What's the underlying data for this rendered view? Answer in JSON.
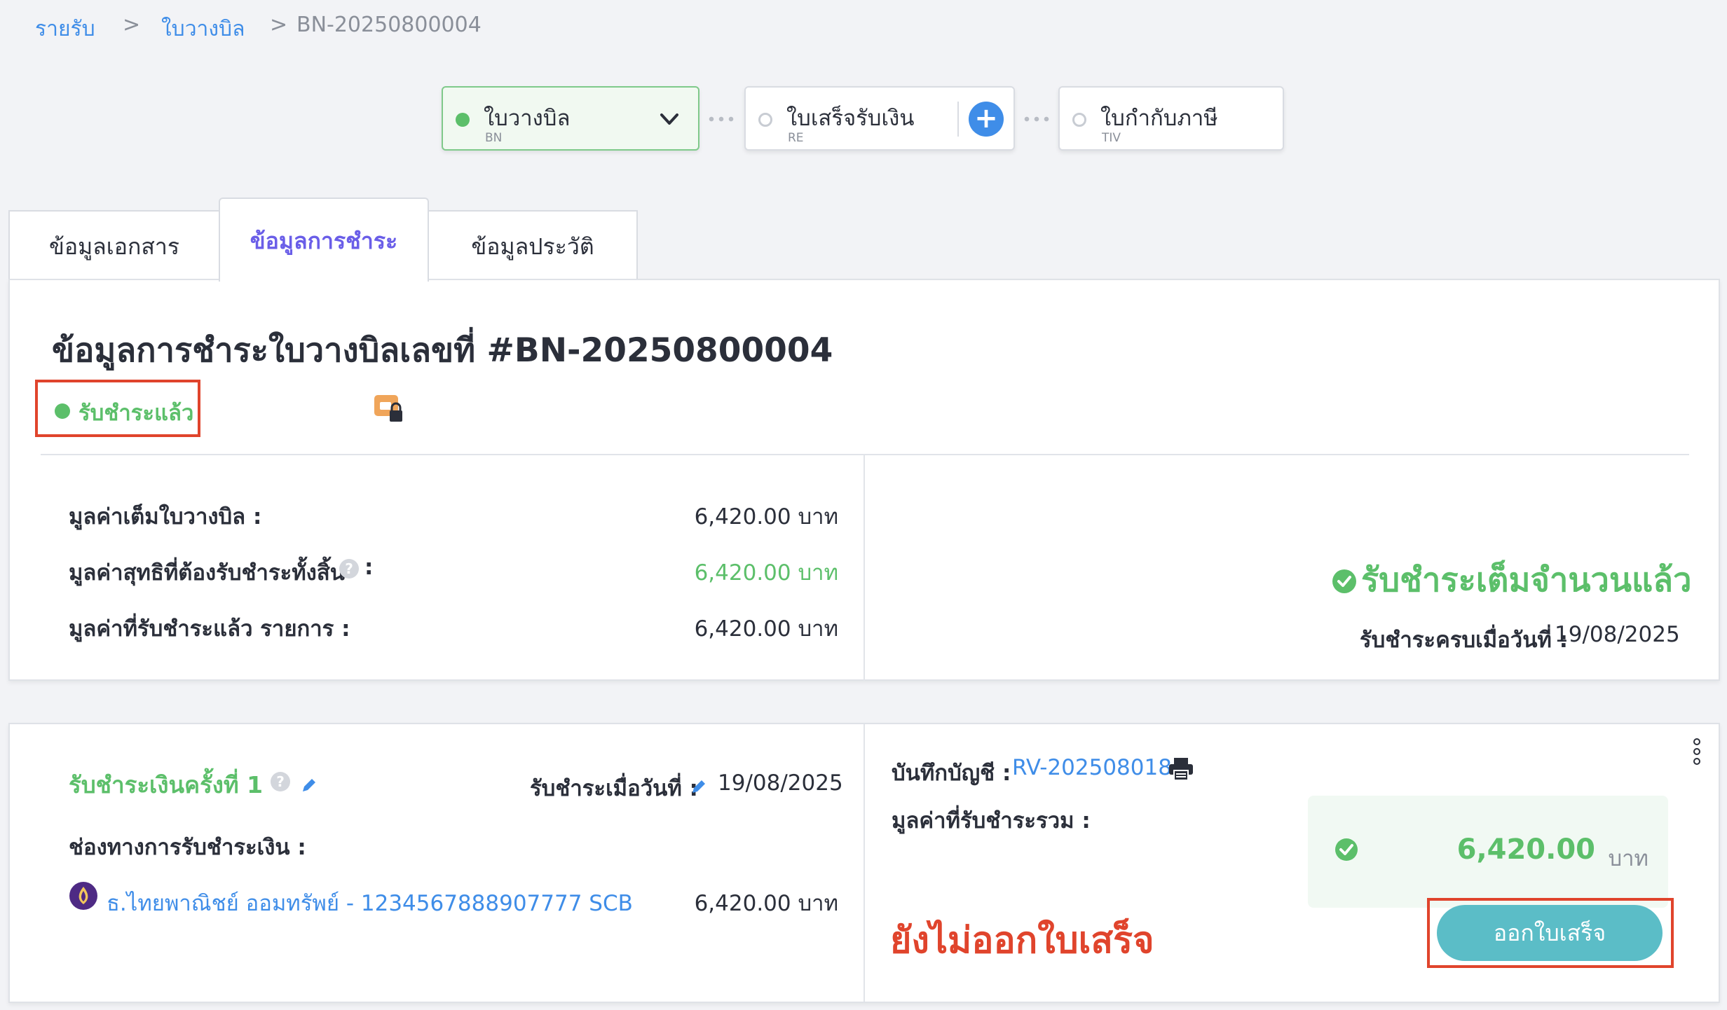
{
  "breadcrumb": {
    "items": [
      "รายรับ",
      "ใบวางบิล"
    ],
    "separator": ">",
    "current": "BN-20250800004"
  },
  "workflow": {
    "steps": [
      {
        "label": "ใบวางบิล",
        "code": "BN"
      },
      {
        "label": "ใบเสร็จรับเงิน",
        "code": "RE"
      },
      {
        "label": "ใบกำกับภาษี",
        "code": "TIV"
      }
    ],
    "add_label": "+"
  },
  "tabs": [
    "ข้อมูลเอกสาร",
    "ข้อมูลการชำระ",
    "ข้อมูลประวัติ"
  ],
  "summary": {
    "title": "ข้อมูลการชำระใบวางบิลเลขที่ #BN-20250800004",
    "status": "รับชำระแล้ว",
    "rows": [
      {
        "label": "มูลค่าเต็มใบวางบิล :",
        "value": "6,420.00 บาท"
      },
      {
        "label": "มูลค่าสุทธิที่ต้องรับชำระทั้งสิ้น",
        "help": "?",
        "colon": ":",
        "value": "6,420.00 บาท"
      },
      {
        "label": "มูลค่าที่รับชำระแล้ว รายการ :",
        "value": "6,420.00 บาท"
      }
    ],
    "full_paid": "รับชำระเต็มจำนวนแล้ว",
    "paid_date_label": "รับชำระครบเมื่อวันที่ :",
    "paid_date": "19/08/2025"
  },
  "payment": {
    "title": "รับชำระเงินครั้งที่ 1",
    "help": "?",
    "date_label": "รับชำระเมื่อวันที่ :",
    "date": "19/08/2025",
    "channel_label": "ช่องทางการรับชำระเงิน :",
    "channel": "ธ.ไทยพาณิชย์ ออมทรัพย์ - 1234567888907777 SCB",
    "channel_amount": "6,420.00 บาท",
    "account_label": "บันทึกบัญชี :",
    "account_ref": "RV-202508018",
    "total_label": "มูลค่าที่รับชำระรวม :",
    "total_amount": "6,420.00",
    "total_unit": "บาท",
    "receipt_status": "ยังไม่ออกใบเสร็จ",
    "issue_button": "ออกใบเสร็จ"
  },
  "colors": {
    "accent_blue": "#3f8de8",
    "success_green": "#5cbf6a",
    "tab_active": "#6a5ee8",
    "warning_red": "#e0442c",
    "button_teal": "#5bbdc7"
  }
}
